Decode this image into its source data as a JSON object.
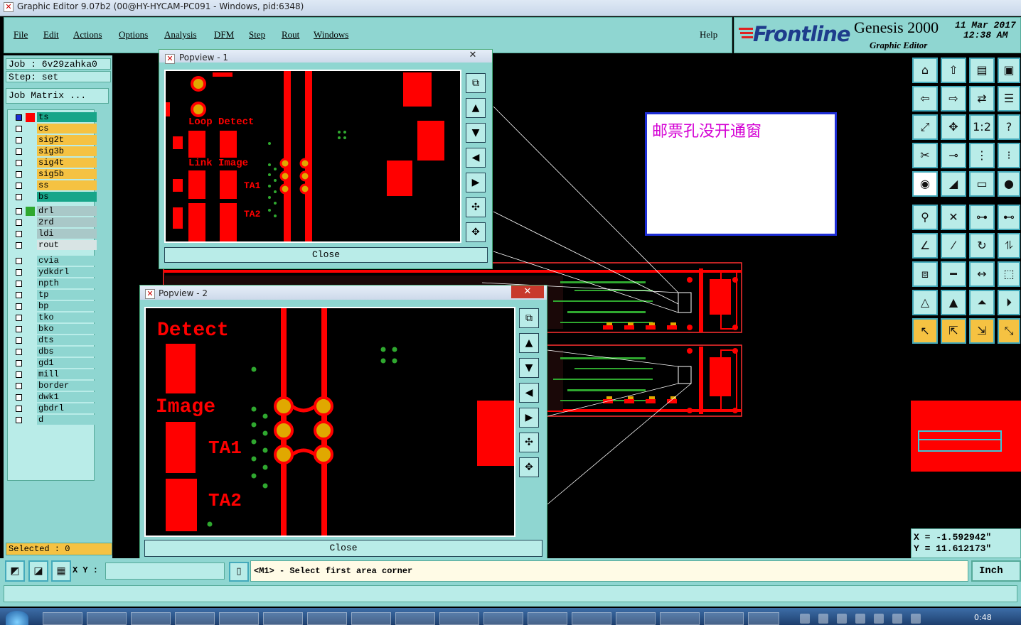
{
  "window": {
    "title": "Graphic Editor 9.07b2 (00@HY-HYCAM-PC091 - Windows, pid:6348)"
  },
  "menu": {
    "items": [
      "File",
      "Edit",
      "Actions",
      "Options",
      "Analysis",
      "DFM",
      "Step",
      "Rout",
      "Windows"
    ],
    "help": "Help"
  },
  "brand": {
    "logo": "Frontline",
    "product": "Genesis 2000",
    "subtitle": "Graphic Editor",
    "date": "11 Mar 2017",
    "time": "12:38 AM"
  },
  "job": {
    "job_line": "Job : 6v29zahka0",
    "step_line": "Step: set",
    "matrix_button": "Job Matrix ..."
  },
  "layers": {
    "group1": [
      "ts",
      "cs",
      "sig2t",
      "sig3b",
      "sig4t",
      "sig5b",
      "ss",
      "bs"
    ],
    "group2": [
      "drl",
      "2rd",
      "ldi",
      "rout"
    ],
    "group3": [
      "cvia",
      "ydkdrl",
      "npth",
      "tp",
      "bp",
      "tko",
      "bko",
      "dts",
      "dbs",
      "gd1",
      "mill",
      "border",
      "dwk1",
      "gbdrl",
      "d"
    ]
  },
  "selected": "Selected : 0",
  "popview1": {
    "title": "Popview - 1",
    "close": "Close",
    "labels": {
      "loop": "Loop Detect",
      "link": "Link Image",
      "ta1": "TA1",
      "ta2": "TA2"
    }
  },
  "popview2": {
    "title": "Popview - 2",
    "close": "Close",
    "labels": {
      "detect": "Detect",
      "image": "Image",
      "ta1": "TA1",
      "ta2": "TA2"
    }
  },
  "annotation": {
    "text": "邮票孔没开通窗"
  },
  "coords": {
    "x": "X = -1.592942\"",
    "y": "Y = 11.612173\""
  },
  "status": {
    "xy_label": "X Y :",
    "xy_value": "",
    "prompt": "<M1> - Select first area corner",
    "units": "Inch"
  },
  "taskbar": {
    "clock": "0:48"
  },
  "colors": {
    "teal": "#8fd6d1",
    "light_teal": "#b9ece8",
    "red": "#ff0000",
    "dark": "#000000",
    "green_pad": "#1e8f1e",
    "gold": "#e0a800",
    "layer_yellow": "#f5c242",
    "layer_green": "#17a589",
    "annotation_text": "#d400d4"
  }
}
